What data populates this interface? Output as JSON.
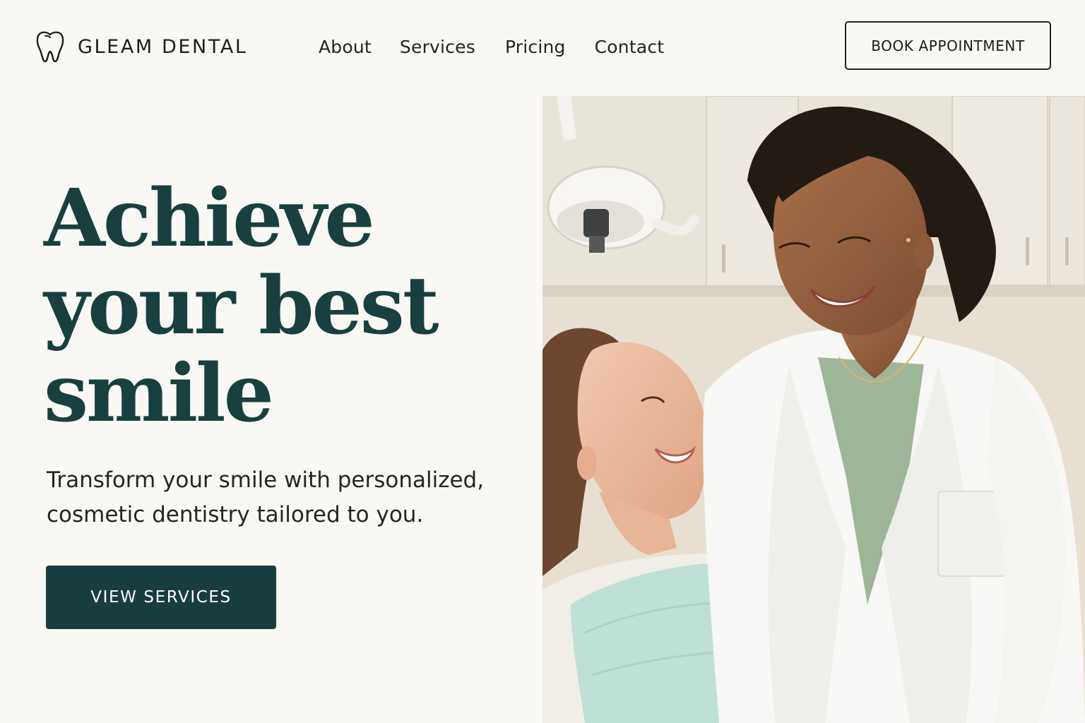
{
  "brand": {
    "name": "GLEAM DENTAL",
    "logo_icon": "tooth-icon"
  },
  "nav": {
    "items": [
      {
        "label": "About"
      },
      {
        "label": "Services"
      },
      {
        "label": "Pricing"
      },
      {
        "label": "Contact"
      }
    ]
  },
  "header": {
    "cta_label": "BOOK APPOINTMENT"
  },
  "hero": {
    "title_lines": [
      "Achieve",
      "your best",
      "smile"
    ],
    "subtitle_lines": [
      "Transform your smile with personalized,",
      "cosmetic dentistry tailored to you."
    ],
    "cta_label": "VIEW SERVICES",
    "image": "dentist-and-smiling-patient-photo"
  },
  "colors": {
    "background": "#f9f8f5",
    "accent_dark_teal": "#183d3f",
    "heading": "#17403f",
    "text": "#1f2626"
  }
}
